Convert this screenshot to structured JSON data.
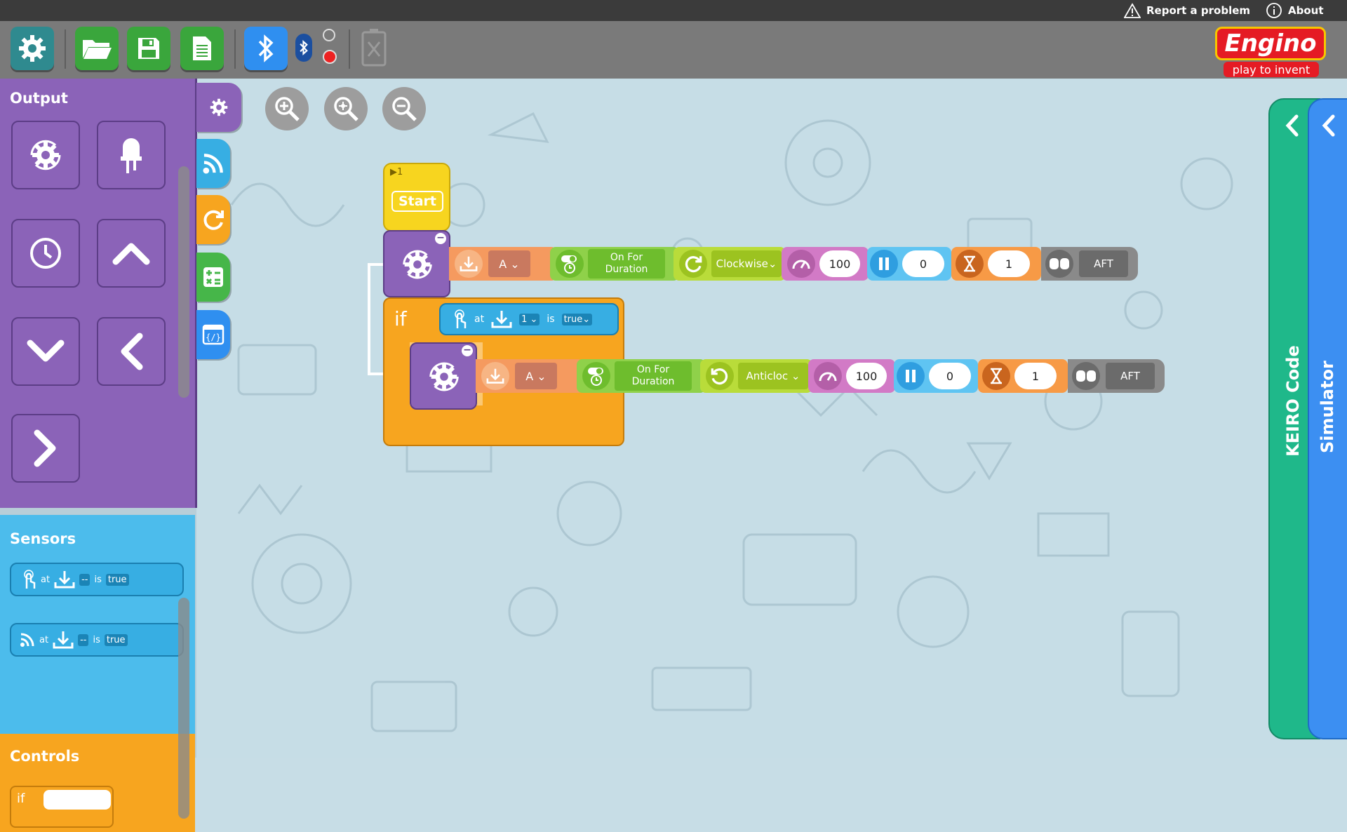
{
  "topbar": {
    "report_label": "Report a problem",
    "about_label": "About"
  },
  "toolbar": {
    "buttons": [
      {
        "name": "settings",
        "icon": "gear-icon",
        "color": "#2f8a8f"
      },
      {
        "name": "open",
        "icon": "folder-open-icon",
        "color": "#3aa63c"
      },
      {
        "name": "save",
        "icon": "save-icon",
        "color": "#3aa63c"
      },
      {
        "name": "new",
        "icon": "document-icon",
        "color": "#3aa63c"
      },
      {
        "name": "bluetooth",
        "icon": "bluetooth-icon",
        "color": "#2f8ff0"
      }
    ]
  },
  "logo": {
    "brand": "Engino",
    "tagline": "play to invent"
  },
  "palette": {
    "output": {
      "title": "Output",
      "color": "#8b63b8",
      "blocks": [
        "motor-gear-icon",
        "led-icon",
        "clock-icon",
        "chevron-up-icon",
        "chevron-down-icon",
        "chevron-left-icon",
        "chevron-right-icon"
      ]
    },
    "sensors": {
      "title": "Sensors",
      "color": "#37aee3",
      "items": [
        {
          "icon": "touch-sensor-icon",
          "at": "at",
          "port": "--",
          "is": "is",
          "value": "true"
        },
        {
          "icon": "ir-sensor-icon",
          "at": "at",
          "port": "--",
          "is": "is",
          "value": "true"
        }
      ]
    },
    "controls": {
      "title": "Controls",
      "color": "#f7a51f",
      "if_label": "if"
    }
  },
  "category_tabs": [
    {
      "name": "output-tab",
      "icon": "gear-icon",
      "color": "#8b63b8"
    },
    {
      "name": "sensors-tab",
      "icon": "signal-icon",
      "color": "#37aee3"
    },
    {
      "name": "loops-tab",
      "icon": "refresh-icon",
      "color": "#f7a51f"
    },
    {
      "name": "math-tab",
      "icon": "calculator-icon",
      "color": "#46b649"
    },
    {
      "name": "variables-tab",
      "icon": "variable-icon",
      "color": "#2f8ff0"
    }
  ],
  "program": {
    "start": {
      "badge": "▶1",
      "label": "Start"
    },
    "motor_block_1": {
      "port": "A",
      "mode_line1": "On For",
      "mode_line2": "Duration",
      "direction": "Clockwise",
      "speed": "100",
      "pause": "0",
      "duration": "1",
      "after": "AFT"
    },
    "if_block": {
      "label": "if",
      "sensor_at": "at",
      "sensor_port": "1",
      "sensor_is": "is",
      "sensor_value": "true"
    },
    "motor_block_2": {
      "port": "A",
      "mode_line1": "On For",
      "mode_line2": "Duration",
      "direction": "Anticloc",
      "speed": "100",
      "pause": "0",
      "duration": "1",
      "after": "AFT"
    }
  },
  "right_panels": {
    "keiro_label": "KEIRO Code",
    "simulator_label": "Simulator",
    "keiro_color": "#1fb88a",
    "simulator_color": "#3c8ff2"
  }
}
